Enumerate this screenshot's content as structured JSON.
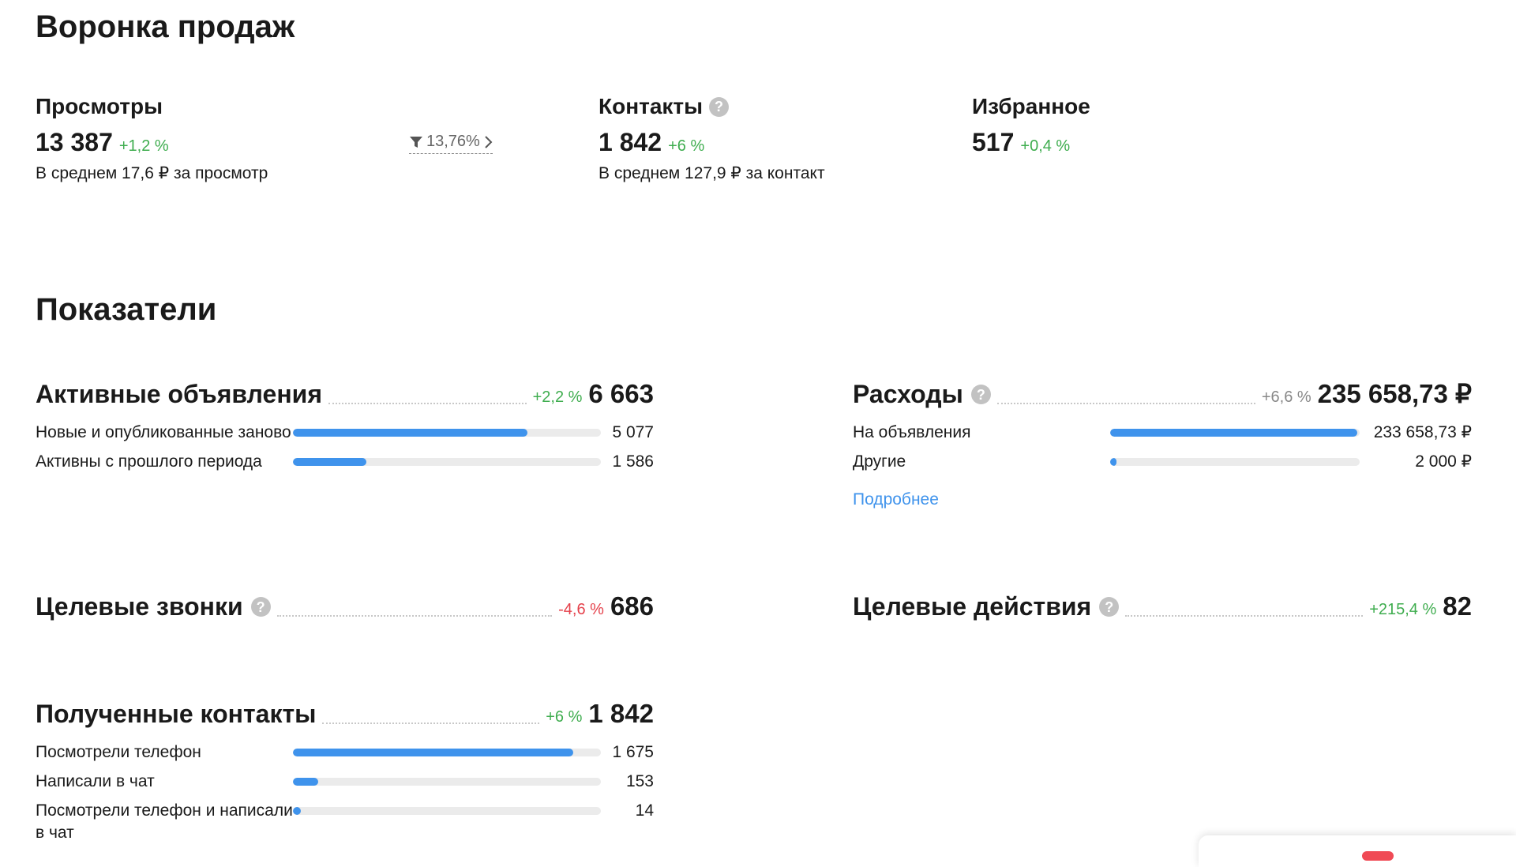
{
  "funnel": {
    "title": "Воронка продаж",
    "views": {
      "label": "Просмотры",
      "value": "13 387",
      "change": "+1,2 %",
      "sub": "В среднем 17,6 ₽ за просмотр"
    },
    "conversion": {
      "value": "13,76%"
    },
    "contacts": {
      "label": "Контакты",
      "value": "1 842",
      "change": "+6 %",
      "sub": "В среднем 127,9 ₽ за контакт"
    },
    "favorites": {
      "label": "Избранное",
      "value": "517",
      "change": "+0,4 %"
    }
  },
  "indicators": {
    "title": "Показатели",
    "active_ads": {
      "title": "Активные объявления",
      "change": "+2,2 %",
      "total": "6 663",
      "rows": [
        {
          "label": "Новые и опубликованные заново",
          "value": "5 077",
          "fraction": 0.762
        },
        {
          "label": "Активны с прошлого периода",
          "value": "1 586",
          "fraction": 0.238
        }
      ]
    },
    "expenses": {
      "title": "Расходы",
      "change": "+6,6 %",
      "total": "235 658,73 ₽",
      "rows": [
        {
          "label": "На объявления",
          "value": "233 658,73 ₽",
          "fraction": 0.992
        },
        {
          "label": "Другие",
          "value": "2 000 ₽",
          "fraction": 0.0085
        }
      ],
      "more_link": "Подробнее"
    },
    "target_calls": {
      "title": "Целевые звонки",
      "change": "-4,6 %",
      "total": "686"
    },
    "target_actions": {
      "title": "Целевые действия",
      "change": "+215,4 %",
      "total": "82"
    },
    "received_contacts": {
      "title": "Полученные контакты",
      "change": "+6 %",
      "total": "1 842",
      "rows": [
        {
          "label": "Посмотрели телефон",
          "value": "1 675",
          "fraction": 0.909
        },
        {
          "label": "Написали в чат",
          "value": "153",
          "fraction": 0.083
        },
        {
          "label": "Посмотрели телефон и написали в чат",
          "value": "14",
          "fraction": 0.0076
        }
      ]
    }
  },
  "icons": {
    "help": "question-mark-icon",
    "filter": "funnel-filter-icon",
    "chevron": "chevron-right-icon"
  },
  "colors": {
    "positive": "#3fad4f",
    "negative": "#e5414b",
    "bar": "#3f93ec",
    "link": "#3f93ec"
  }
}
